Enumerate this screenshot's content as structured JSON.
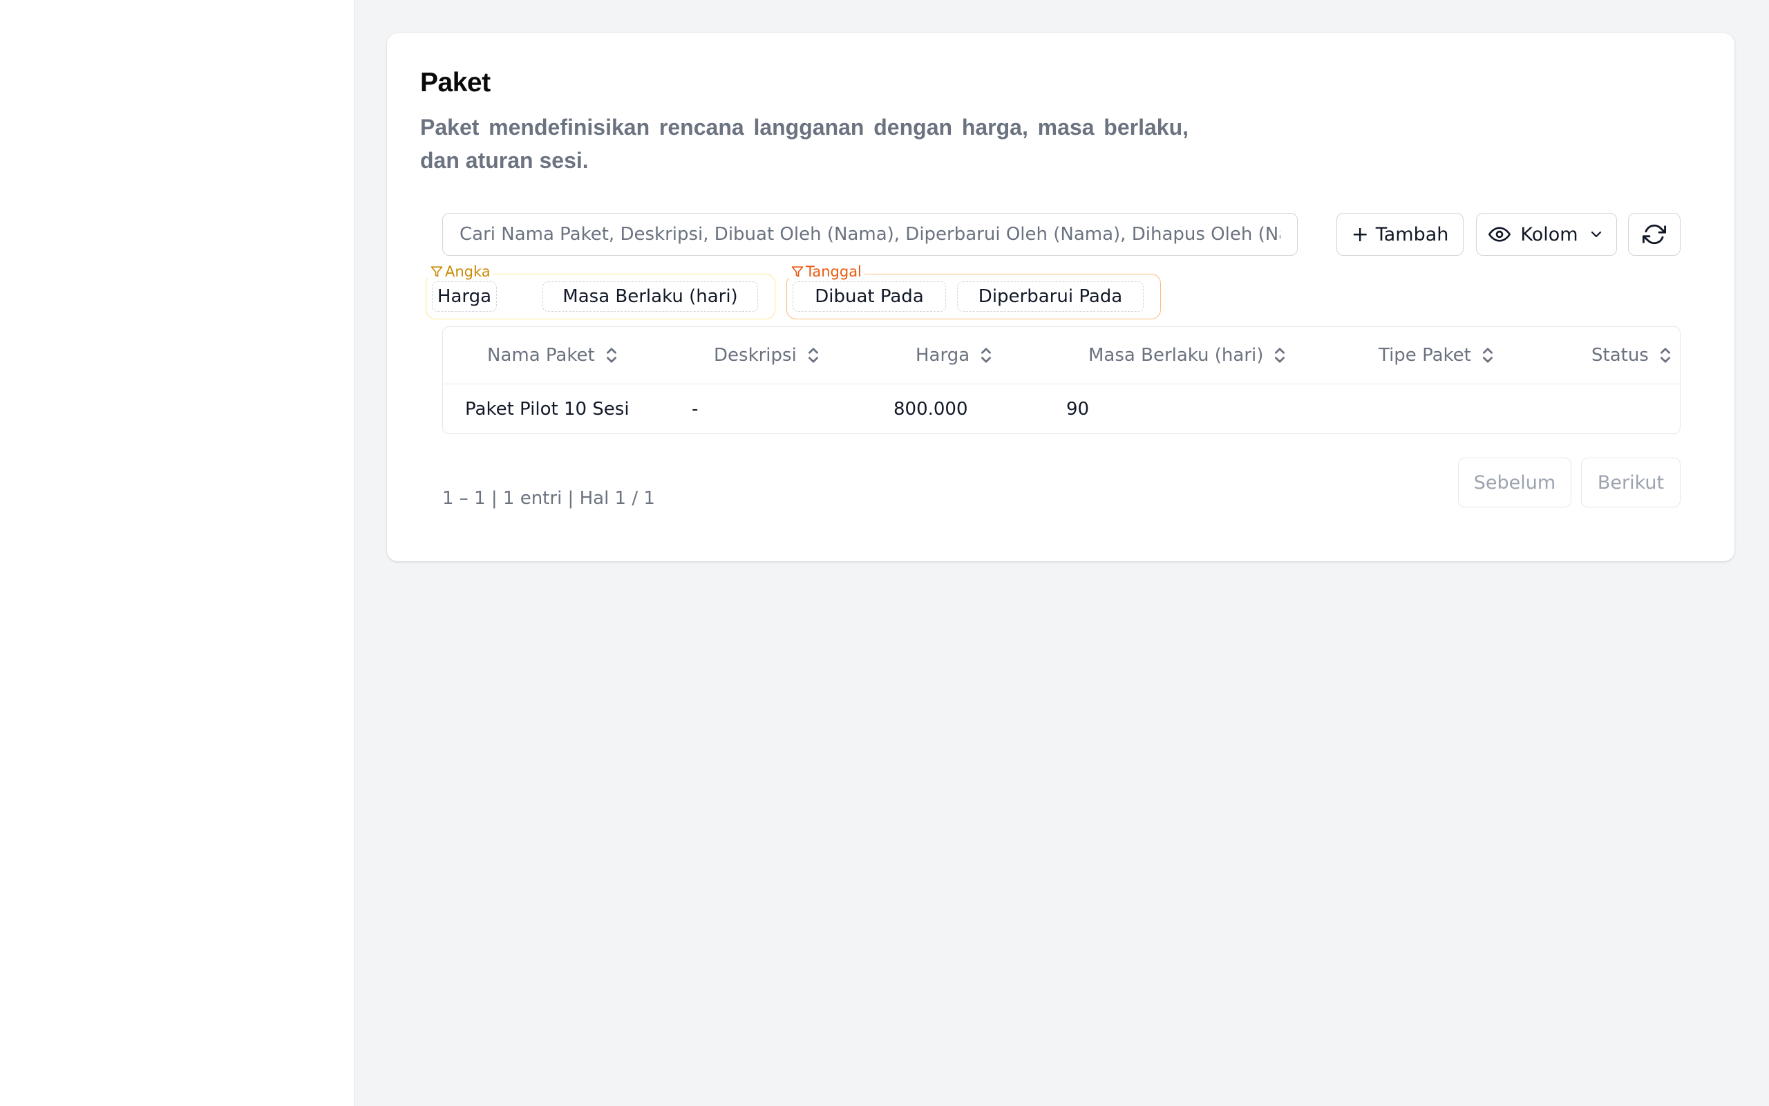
{
  "page": {
    "title": "Paket",
    "description": "Paket mendefinisikan rencana langganan dengan harga, masa berlaku, dan aturan sesi."
  },
  "toolbar": {
    "search_placeholder": "Cari Nama Paket, Deskripsi, Dibuat Oleh (Nama), Diperbarui Oleh (Nama), Dihapus Oleh (Nama)",
    "search_value": "",
    "add_label": "Tambah",
    "columns_label": "Kolom"
  },
  "filters": {
    "number": {
      "label": "Angka",
      "chips": [
        "Harga",
        "Masa Berlaku (hari)"
      ]
    },
    "date": {
      "label": "Tanggal",
      "chips": [
        "Dibuat Pada",
        "Diperbarui Pada"
      ]
    }
  },
  "table": {
    "columns": [
      "Nama Paket",
      "Deskripsi",
      "Harga",
      "Masa Berlaku (hari)",
      "Tipe Paket",
      "Status"
    ],
    "rows": [
      [
        "Paket Pilot 10 Sesi",
        "-",
        "800.000",
        "90",
        "",
        ""
      ]
    ]
  },
  "pagination": {
    "info": "1 – 1 | 1 entri | Hal 1 / 1",
    "prev_label": "Sebelum",
    "next_label": "Berikut"
  },
  "icons": {
    "add": "plus-icon",
    "columns": "eye-icon",
    "columns_dropdown": "chevron-down-icon",
    "refresh": "refresh-icon",
    "filter": "filter-icon",
    "sort": "sort-icon"
  },
  "colors": {
    "number_filter_accent": "#ca8a04",
    "date_filter_accent": "#ea580c",
    "muted_text": "#6b7280"
  }
}
